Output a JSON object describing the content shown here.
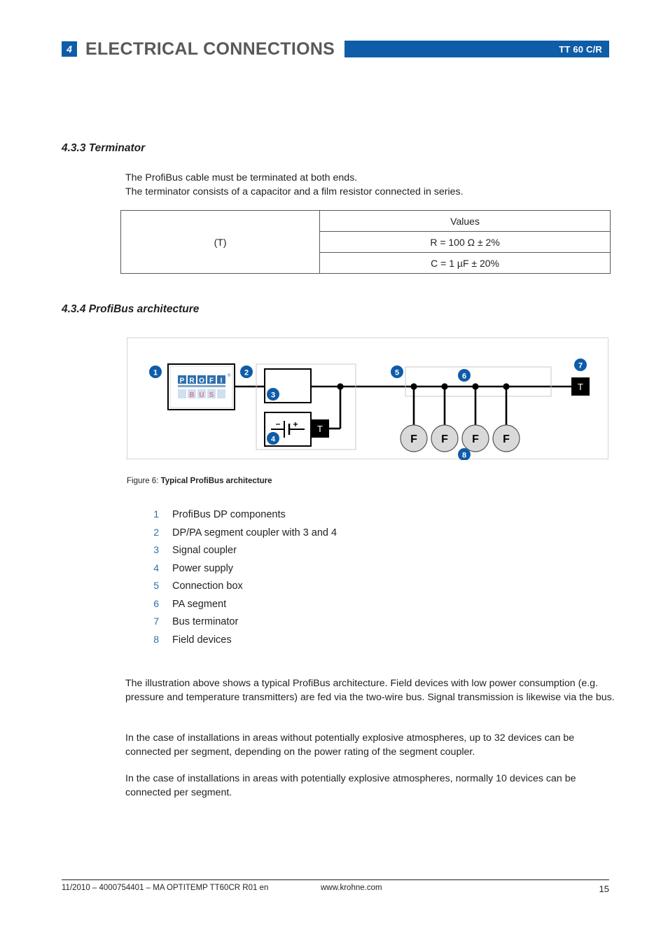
{
  "header": {
    "chapter_number": "4",
    "chapter_title": "ELECTRICAL CONNECTIONS",
    "product_label": "TT 60 C/R",
    "accent_color": "#0f5ca8",
    "title_color": "#58595b"
  },
  "sections": {
    "terminator": {
      "heading": "4.3.3  Terminator",
      "line1": "The ProfiBus cable must be terminated at both ends.",
      "line2": "The terminator consists of a capacitor and a film resistor connected in series."
    },
    "architecture": {
      "heading": "4.3.4  ProfiBus architecture"
    }
  },
  "values_table": {
    "corner_cell": "",
    "values_header": "Values",
    "row_label": "(T)",
    "resistor_value": "R = 100 Ω  ± 2%",
    "capacitor_value": "C = 1 µF ±  20%"
  },
  "figure": {
    "caption_label": "Figure 6: ",
    "caption_title": "Typical ProfiBus architecture",
    "badge_color": "#0f5ca8",
    "device_fill": "#d9d9d9",
    "terminator_fill": "#000000",
    "logo_top_text": "PROFI",
    "logo_bottom_text": "BUS",
    "logo_registered": "®",
    "terminator_letter": "T",
    "field_device_letter": "F",
    "power_minus": "–",
    "power_plus": "+",
    "badges": [
      "1",
      "2",
      "3",
      "4",
      "5",
      "6",
      "7",
      "8"
    ]
  },
  "legend": {
    "items": [
      {
        "num": "1",
        "label": "ProfiBus DP components"
      },
      {
        "num": "2",
        "label": "DP/PA segment coupler with 3 and 4"
      },
      {
        "num": "3",
        "label": "Signal coupler"
      },
      {
        "num": "4",
        "label": "Power supply"
      },
      {
        "num": "5",
        "label": "Connection box"
      },
      {
        "num": "6",
        "label": "PA segment"
      },
      {
        "num": "7",
        "label": "Bus terminator"
      },
      {
        "num": "8",
        "label": "Field devices"
      }
    ]
  },
  "body": {
    "paragraph_1": "The illustration above shows a typical ProfiBus architecture. Field devices with low power consumption (e.g. pressure and temperature transmitters) are fed via the two-wire bus. Signal transmission is likewise via the bus.",
    "paragraph_2": "In the case of installations in areas without potentially explosive atmospheres, up to 32 devices can be connected per segment, depending on the power rating of the segment coupler.",
    "paragraph_3": "In the case of installations in areas with potentially explosive atmospheres, normally 10 devices can be connected per segment."
  },
  "footer": {
    "left": "11/2010 – 4000754401 – MA OPTITEMP TT60CR R01 en",
    "center": "www.krohne.com",
    "page_number": "15"
  }
}
